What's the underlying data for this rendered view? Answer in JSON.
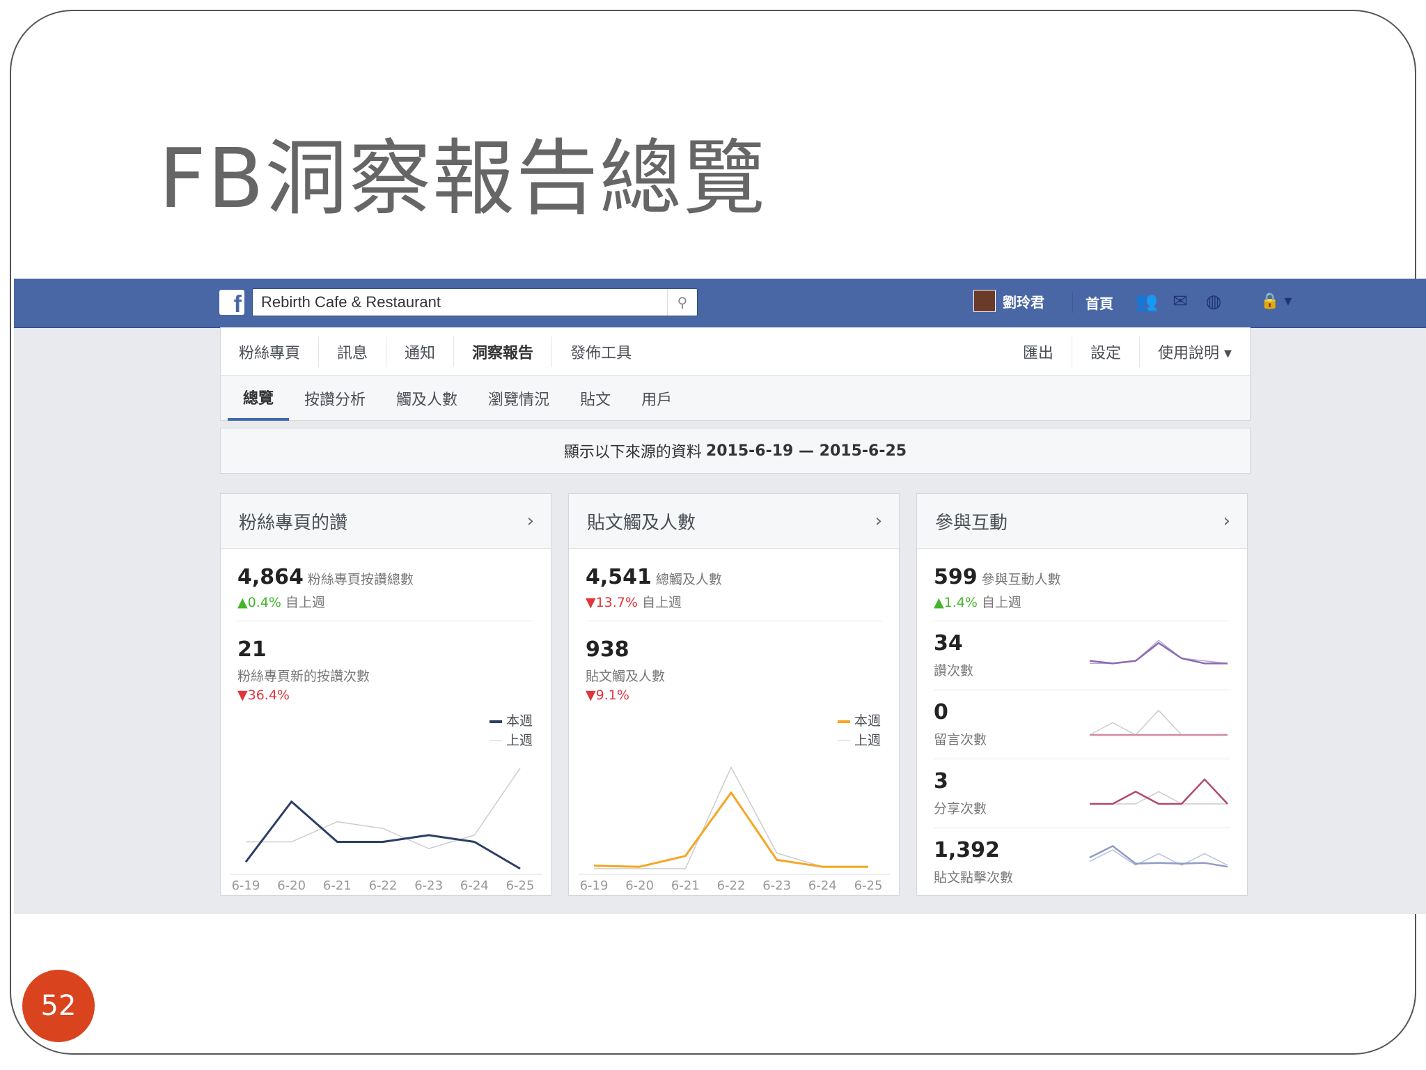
{
  "slide": {
    "title": "FB洞察報告總覽",
    "page_number": "52"
  },
  "topbar": {
    "search_value": "Rebirth Cafe & Restaurant",
    "user_name": "劉玲君",
    "home_label": "首頁"
  },
  "nav": {
    "left": [
      "粉絲專頁",
      "訊息",
      "通知",
      "洞察報告",
      "發佈工具"
    ],
    "right": [
      "匯出",
      "設定",
      "使用說明 ▾"
    ],
    "active": "洞察報告"
  },
  "subnav": {
    "items": [
      "總覽",
      "按讚分析",
      "觸及人數",
      "瀏覽情況",
      "貼文",
      "用戶"
    ],
    "active": "總覽"
  },
  "date_bar": {
    "prefix": "顯示以下來源的資料",
    "range": "2015-6-19 — 2015-6-25"
  },
  "legend": {
    "this_week": "本週",
    "last_week": "上週"
  },
  "colors": {
    "fb_blue": "#4a67a5",
    "likes_series": "#2c3e66",
    "reach_series": "#f5a623",
    "up": "#42b72a",
    "down": "#e0353a",
    "badge": "#d9431d"
  },
  "cards": {
    "likes": {
      "title": "粉絲專頁的讚",
      "main_value": "4,864",
      "main_label": "粉絲專頁按讚總數",
      "main_change": "0.4%",
      "main_change_dir": "up",
      "since_label": "自上週",
      "sub_value": "21",
      "sub_label": "粉絲專頁新的按讚次數",
      "sub_change": "36.4%",
      "sub_change_dir": "down"
    },
    "reach": {
      "title": "貼文觸及人數",
      "main_value": "4,541",
      "main_label": "總觸及人數",
      "main_change": "13.7%",
      "main_change_dir": "down",
      "since_label": "自上週",
      "sub_value": "938",
      "sub_label": "貼文觸及人數",
      "sub_change": "9.1%",
      "sub_change_dir": "down"
    },
    "engagement": {
      "title": "參與互動",
      "main_value": "599",
      "main_label": "參與互動人數",
      "main_change": "1.4%",
      "main_change_dir": "up",
      "since_label": "自上週",
      "rows": [
        {
          "value": "34",
          "label": "讚次數"
        },
        {
          "value": "0",
          "label": "留言次數"
        },
        {
          "value": "3",
          "label": "分享次數"
        },
        {
          "value": "1,392",
          "label": "貼文點擊次數"
        }
      ]
    }
  },
  "chart_data": [
    {
      "type": "line",
      "name": "likes-chart",
      "x": [
        "6-19",
        "6-20",
        "6-21",
        "6-22",
        "6-23",
        "6-24",
        "6-25"
      ],
      "series": [
        {
          "name": "本週",
          "values": [
            1,
            10,
            4,
            4,
            5,
            4,
            0
          ]
        },
        {
          "name": "上週",
          "values": [
            4,
            4,
            7,
            6,
            3,
            5,
            15
          ]
        }
      ],
      "ylim": [
        0,
        16
      ]
    },
    {
      "type": "line",
      "name": "reach-chart",
      "x": [
        "6-19",
        "6-20",
        "6-21",
        "6-22",
        "6-23",
        "6-24",
        "6-25"
      ],
      "series": [
        {
          "name": "本週",
          "values": [
            30,
            20,
            130,
            780,
            90,
            20,
            20
          ]
        },
        {
          "name": "上週",
          "values": [
            0,
            0,
            0,
            1040,
            160,
            20,
            20
          ]
        }
      ],
      "ylim": [
        0,
        1100
      ]
    },
    {
      "type": "line",
      "name": "likes-sparkline",
      "x": [
        "6-19",
        "6-20",
        "6-21",
        "6-22",
        "6-23",
        "6-24",
        "6-25"
      ],
      "series": [
        {
          "name": "本週",
          "values": [
            2,
            1,
            2,
            9,
            3,
            1,
            1
          ]
        },
        {
          "name": "上週",
          "values": [
            1,
            1,
            2,
            10,
            3,
            2,
            1
          ]
        }
      ],
      "ylim": [
        0,
        12
      ]
    },
    {
      "type": "line",
      "name": "comments-sparkline",
      "x": [
        "6-19",
        "6-20",
        "6-21",
        "6-22",
        "6-23",
        "6-24",
        "6-25"
      ],
      "series": [
        {
          "name": "本週",
          "values": [
            0,
            0,
            0,
            0,
            0,
            0,
            0
          ]
        },
        {
          "name": "上週",
          "values": [
            0,
            1,
            0,
            2,
            0,
            0,
            0
          ]
        }
      ],
      "ylim": [
        0,
        2.5
      ]
    },
    {
      "type": "line",
      "name": "shares-sparkline",
      "x": [
        "6-19",
        "6-20",
        "6-21",
        "6-22",
        "6-23",
        "6-24",
        "6-25"
      ],
      "series": [
        {
          "name": "本週",
          "values": [
            0,
            0,
            1,
            0,
            0,
            2,
            0
          ]
        },
        {
          "name": "上週",
          "values": [
            0,
            0,
            0,
            1,
            0,
            0,
            0
          ]
        }
      ],
      "ylim": [
        0,
        2.5
      ]
    },
    {
      "type": "line",
      "name": "clicks-sparkline",
      "x": [
        "6-19",
        "6-20",
        "6-21",
        "6-22",
        "6-23",
        "6-24",
        "6-25"
      ],
      "series": [
        {
          "name": "本週",
          "values": [
            200,
            350,
            120,
            130,
            120,
            130,
            80
          ]
        },
        {
          "name": "上週",
          "values": [
            150,
            300,
            100,
            250,
            100,
            250,
            100
          ]
        }
      ],
      "ylim": [
        0,
        400
      ]
    }
  ]
}
